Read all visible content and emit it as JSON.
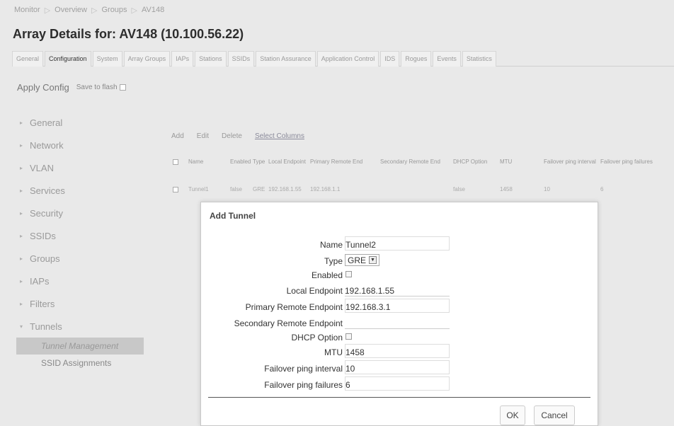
{
  "breadcrumb": [
    "Monitor",
    "Overview",
    "Groups",
    "AV148"
  ],
  "page_title": "Array Details for: AV148 (10.100.56.22)",
  "tabs": [
    "General",
    "Configuration",
    "System",
    "Array Groups",
    "IAPs",
    "Stations",
    "SSIDs",
    "Station Assurance",
    "Application Control",
    "IDS",
    "Rogues",
    "Events",
    "Statistics"
  ],
  "active_tab": "Configuration",
  "apply_config": "Apply Config",
  "save_to_flash": "Save to flash",
  "sidebar": {
    "items": [
      {
        "label": "General",
        "arrow": "▸"
      },
      {
        "label": "Network",
        "arrow": "▸"
      },
      {
        "label": "VLAN",
        "arrow": "▸"
      },
      {
        "label": "Services",
        "arrow": "▸"
      },
      {
        "label": "Security",
        "arrow": "▸"
      },
      {
        "label": "SSIDs",
        "arrow": "▸"
      },
      {
        "label": "Groups",
        "arrow": "▸"
      },
      {
        "label": "IAPs",
        "arrow": "▸"
      },
      {
        "label": "Filters",
        "arrow": "▸"
      },
      {
        "label": "Tunnels",
        "arrow": "▾"
      }
    ],
    "sub_items": [
      "Tunnel Management",
      "SSID Assignments"
    ]
  },
  "grid_toolbar": {
    "add": "Add",
    "edit": "Edit",
    "delete": "Delete",
    "select_columns": "Select Columns"
  },
  "grid_columns": [
    "Name",
    "Enabled",
    "Type",
    "Local Endpoint",
    "Primary Remote End",
    "Secondary Remote End",
    "DHCP Option",
    "MTU",
    "Failover ping interval",
    "Failover ping failures"
  ],
  "grid_row": {
    "name": "Tunnel1",
    "enabled": "false",
    "type": "GRE",
    "local": "192.168.1.55",
    "primary": "192.168.1.1",
    "dhcp": "false",
    "mtu": "1458",
    "interval": "10",
    "failures": "6"
  },
  "modal": {
    "title": "Add Tunnel",
    "fields": {
      "name_label": "Name",
      "name_value": "Tunnel2",
      "type_label": "Type",
      "type_value": "GRE",
      "enabled_label": "Enabled",
      "local_label": "Local Endpoint",
      "local_value": "192.168.1.55",
      "primary_label": "Primary Remote Endpoint",
      "primary_value": "192.168.3.1",
      "secondary_label": "Secondary Remote Endpoint",
      "secondary_value": "",
      "dhcp_label": "DHCP Option",
      "mtu_label": "MTU",
      "mtu_value": "1458",
      "interval_label": "Failover ping interval",
      "interval_value": "10",
      "failures_label": "Failover ping failures",
      "failures_value": "6"
    },
    "ok": "OK",
    "cancel": "Cancel"
  }
}
